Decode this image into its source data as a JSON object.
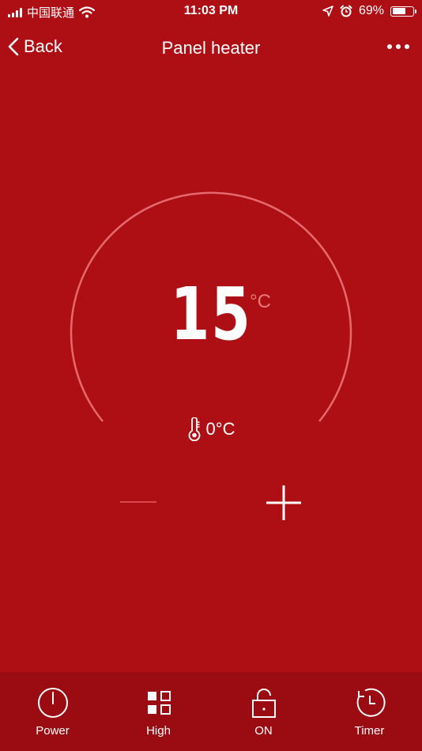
{
  "status_bar": {
    "carrier": "中国联通",
    "time": "11:03 PM",
    "battery_percent": "69%",
    "battery_level": 0.69,
    "icons": [
      "signal-icon",
      "wifi-icon",
      "location-icon",
      "alarm-icon",
      "battery-icon"
    ]
  },
  "nav": {
    "back_label": "Back",
    "title": "Panel heater",
    "back_icon": "chevron-left-icon",
    "more_icon": "more-icon"
  },
  "thermostat": {
    "setpoint": "15",
    "setpoint_unit": "°C",
    "current_temperature": "0°C",
    "thermometer_icon": "thermometer-icon",
    "decrease_icon": "minus-icon",
    "increase_icon": "plus-icon"
  },
  "tabs": [
    {
      "label": "Power",
      "icon": "power-icon"
    },
    {
      "label": "High",
      "icon": "mode-icon"
    },
    {
      "label": "ON",
      "icon": "lock-icon"
    },
    {
      "label": "Timer",
      "icon": "timer-icon"
    }
  ],
  "colors": {
    "background": "#ad0f14",
    "tab_bar": "#9a0c12",
    "unit_accent": "#e87b7b",
    "arc": "#e56a6e"
  }
}
